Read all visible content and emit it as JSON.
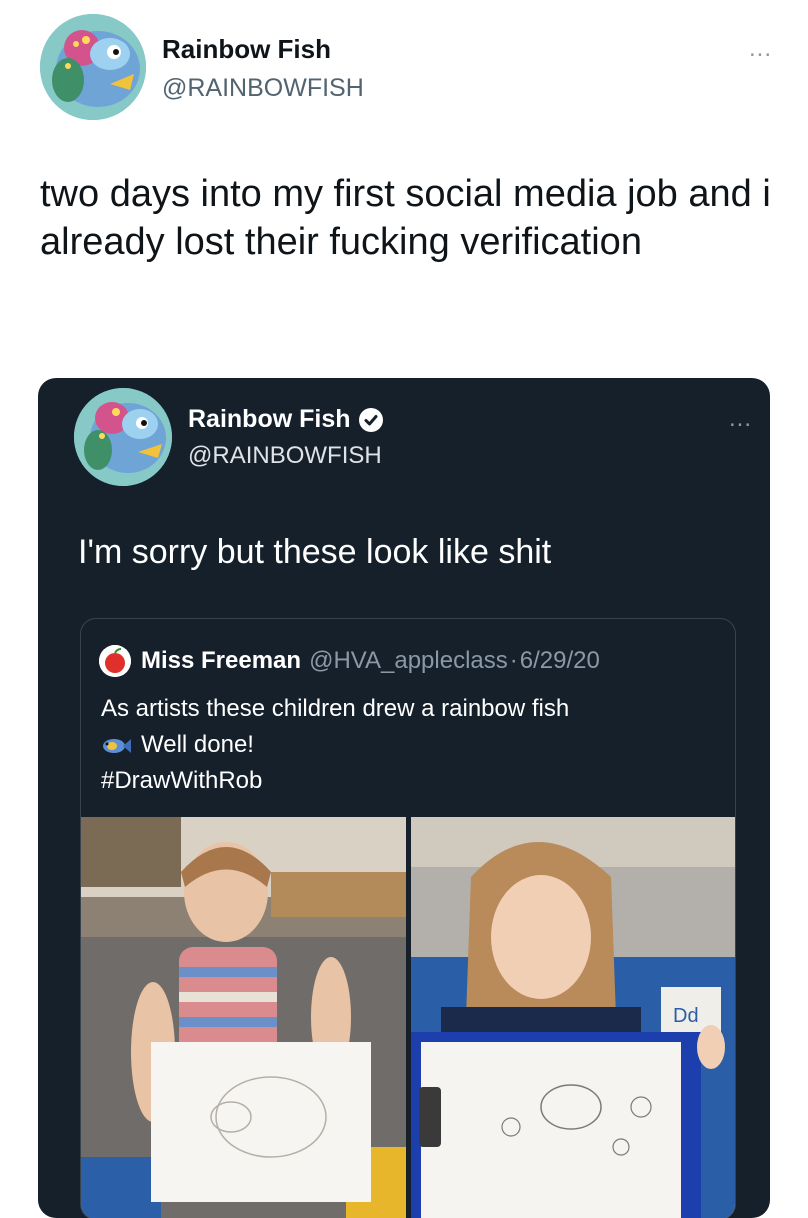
{
  "outer_tweet": {
    "name": "Rainbow Fish",
    "handle": "@RAINBOWFISH",
    "text": "two days into my first social media job and i already lost their fucking verification",
    "more": "..."
  },
  "inner_tweet": {
    "name": "Rainbow Fish",
    "handle": "@RAINBOWFISH",
    "text": "I'm sorry but these look like shit",
    "more": "...",
    "quoted": {
      "author": "Miss Freeman",
      "handle": "@HVA_appleclass",
      "separator": "·",
      "date": "6/29/20",
      "line1": "As artists these children drew a rainbow fish",
      "line2": "Well done!",
      "line3": "#DrawWithRob",
      "photo_sign": "Dd"
    }
  },
  "colors": {
    "card_bg": "#15202b",
    "border": "#38444d",
    "muted": "#8b98a5"
  }
}
